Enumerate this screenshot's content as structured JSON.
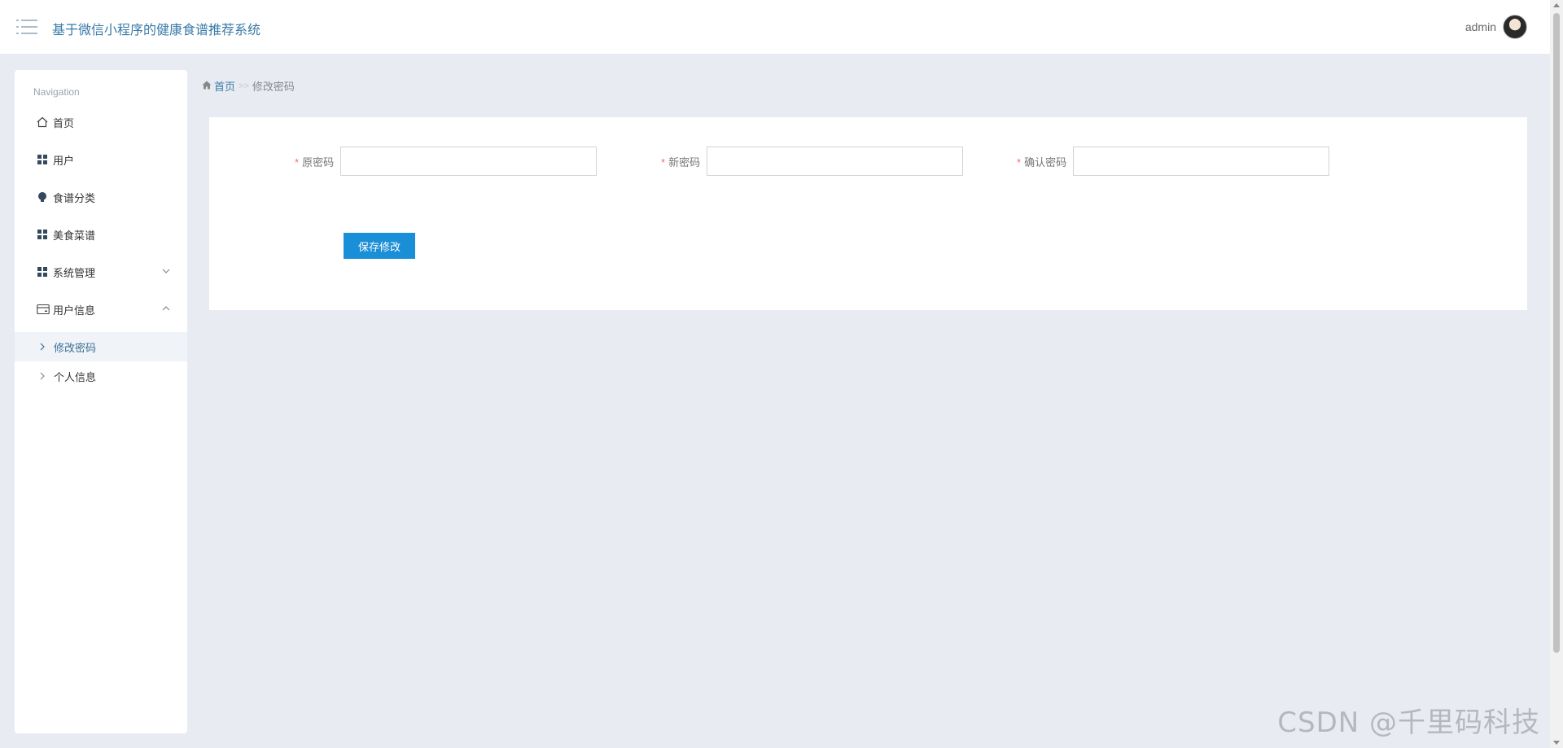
{
  "app": {
    "title": "基于微信小程序的健康食谱推荐系统"
  },
  "header": {
    "user_name": "admin"
  },
  "sidebar": {
    "heading": "Navigation",
    "items": [
      {
        "label": "首页",
        "icon": "home-icon"
      },
      {
        "label": "用户",
        "icon": "grid-icon"
      },
      {
        "label": "食谱分类",
        "icon": "bulb-icon"
      },
      {
        "label": "美食菜谱",
        "icon": "grid-icon"
      },
      {
        "label": "系统管理",
        "icon": "grid-icon",
        "expanded": false
      },
      {
        "label": "用户信息",
        "icon": "card-icon",
        "expanded": true
      }
    ],
    "subitems": [
      {
        "label": "修改密码",
        "active": true
      },
      {
        "label": "个人信息",
        "active": false
      }
    ]
  },
  "breadcrumb": {
    "home": "首页",
    "separator": ">>",
    "current": "修改密码"
  },
  "form": {
    "old_password_label": "原密码",
    "new_password_label": "新密码",
    "confirm_password_label": "确认密码",
    "required_mark": "*",
    "old_password_value": "",
    "new_password_value": "",
    "confirm_password_value": "",
    "save_label": "保存修改"
  },
  "watermark": "CSDN @千里码科技",
  "colors": {
    "accent": "#1a8ed6",
    "title": "#3a7aa8",
    "background": "#e8ecf2",
    "required": "#f56c6c"
  }
}
